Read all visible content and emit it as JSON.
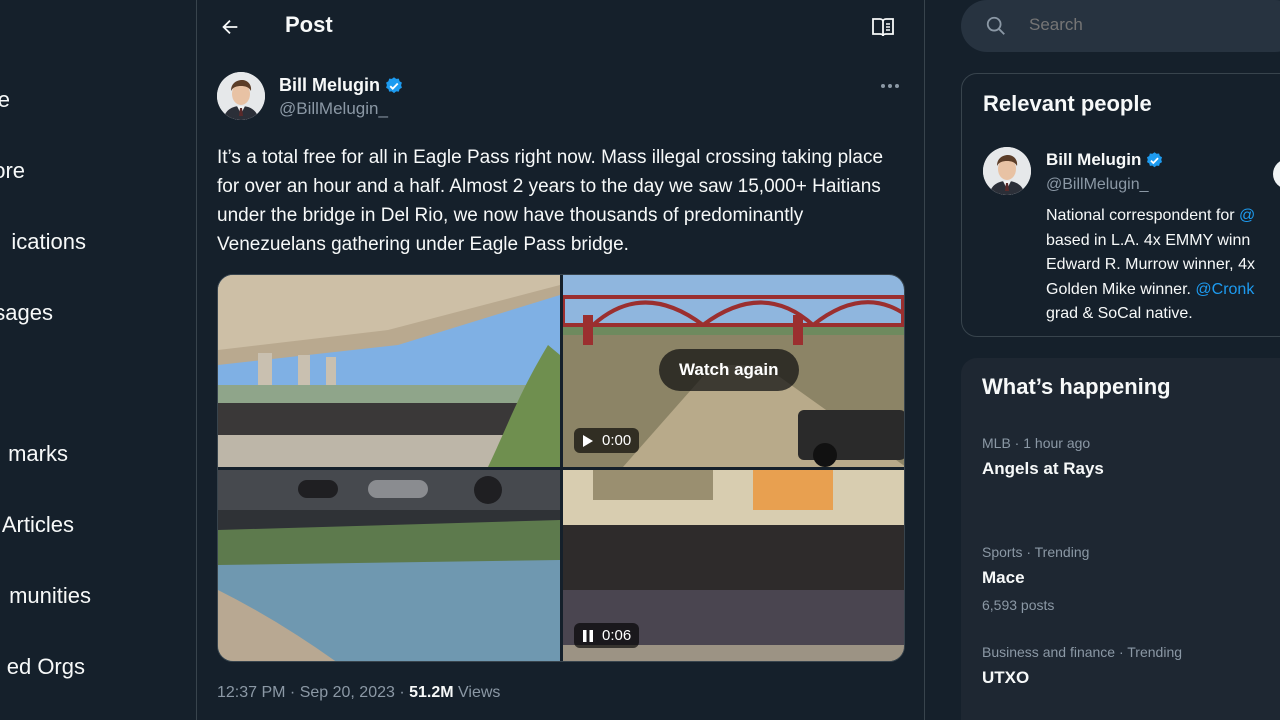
{
  "nav": {
    "items": [
      {
        "label": "e"
      },
      {
        "label": "ore"
      },
      {
        "label": "ications"
      },
      {
        "label": "sages"
      },
      {
        "label": "marks"
      },
      {
        "label": "Articles"
      },
      {
        "label": "munities"
      },
      {
        "label": "ed Orgs"
      }
    ]
  },
  "header": {
    "title": "Post"
  },
  "post": {
    "author_name": "Bill Melugin",
    "author_handle": "@BillMelugin_",
    "text": "It’s a total free for all in Eagle Pass right now. Mass illegal crossing taking place for over an hour and a half. Almost 2 years to the day we saw 15,000+ Haitians under the bridge in Del Rio, we now have thousands of predominantly Venezuelans gathering under Eagle Pass bridge.",
    "media": {
      "watch_again": "Watch again",
      "video1_time": "0:00",
      "video2_time": "0:06"
    },
    "timestamp": "12:37 PM · Sep 20, 2023 · ",
    "views_count": "51.2M",
    "views_label": " Views"
  },
  "search": {
    "placeholder": "Search"
  },
  "relevant": {
    "title": "Relevant people",
    "name": "Bill Melugin",
    "handle": "@BillMelugin_",
    "bio_lines": [
      "National correspondent for ",
      "based in L.A. 4x EMMY winn",
      "Edward R. Murrow winner, 4x",
      "Golden Mike winner. ",
      "grad & SoCal native."
    ],
    "bio_link1": "@",
    "bio_link2": "@Cronk"
  },
  "happening": {
    "title": "What’s happening",
    "trends": [
      {
        "category": "MLB · 1 hour ago",
        "name": "Angels at Rays",
        "posts": ""
      },
      {
        "category": "Sports · Trending",
        "name": "Mace",
        "posts": "6,593 posts"
      },
      {
        "category": "Business and finance · Trending",
        "name": "UTXO",
        "posts": ""
      }
    ]
  },
  "colors": {
    "accent": "#1d9bf0",
    "background": "#15202b",
    "verified": "#1d9bf0"
  }
}
